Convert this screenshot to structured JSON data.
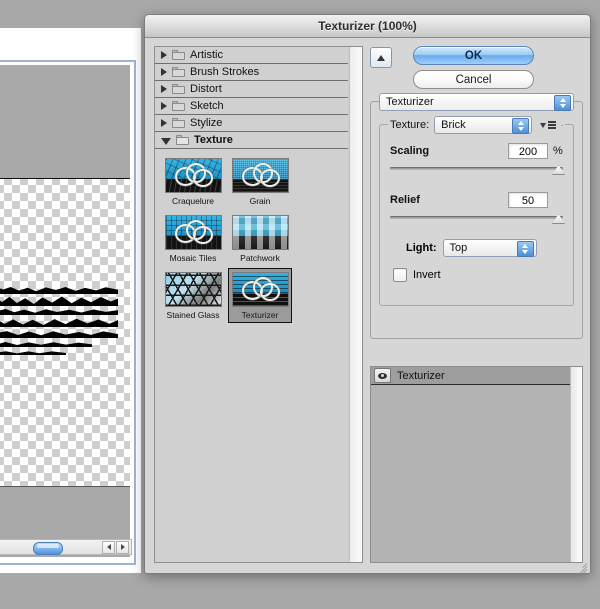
{
  "window": {
    "title": "Texturizer (100%)"
  },
  "document_preview": {
    "name": "canvas-preview",
    "scrollbar": {
      "left_arrow": "scroll-left",
      "right_arrow": "scroll-right"
    }
  },
  "filter_tree": {
    "categories": [
      {
        "label": "Artistic",
        "expanded": false
      },
      {
        "label": "Brush Strokes",
        "expanded": false
      },
      {
        "label": "Distort",
        "expanded": false
      },
      {
        "label": "Sketch",
        "expanded": false
      },
      {
        "label": "Stylize",
        "expanded": false
      },
      {
        "label": "Texture",
        "expanded": true
      }
    ],
    "thumbnails": [
      {
        "label": "Craquelure",
        "selected": false,
        "art": "crq"
      },
      {
        "label": "Grain",
        "selected": false,
        "art": "grn"
      },
      {
        "label": "Mosaic Tiles",
        "selected": false,
        "art": "mos"
      },
      {
        "label": "Patchwork",
        "selected": false,
        "art": "ptc"
      },
      {
        "label": "Stained Glass",
        "selected": false,
        "art": "stg"
      },
      {
        "label": "Texturizer",
        "selected": true,
        "art": "txz"
      }
    ]
  },
  "buttons": {
    "ok": "OK",
    "cancel": "Cancel",
    "collapse": "collapse-panel"
  },
  "settings": {
    "filter_name": "Texturizer",
    "texture_label": "Texture:",
    "texture_value": "Brick",
    "scaling": {
      "label": "Scaling",
      "value": "200",
      "unit": "%",
      "knob_percent": 100
    },
    "relief": {
      "label": "Relief",
      "value": "50",
      "unit": "",
      "knob_percent": 100
    },
    "light": {
      "label": "Light:",
      "value": "Top"
    },
    "invert": {
      "label": "Invert",
      "checked": false
    }
  },
  "effect_layers": {
    "rows": [
      {
        "name": "Texturizer",
        "visible": true,
        "selected": true
      }
    ],
    "tools": {
      "new_layer": "new-effect-layer",
      "delete_layer": "delete-effect-layer"
    }
  },
  "colors": {
    "dialog_bg": "#d6d6d6",
    "accent_blue": "#67aaee",
    "selected_row": "#9e9e9e",
    "selected_thumb": "#9b9b9b"
  }
}
